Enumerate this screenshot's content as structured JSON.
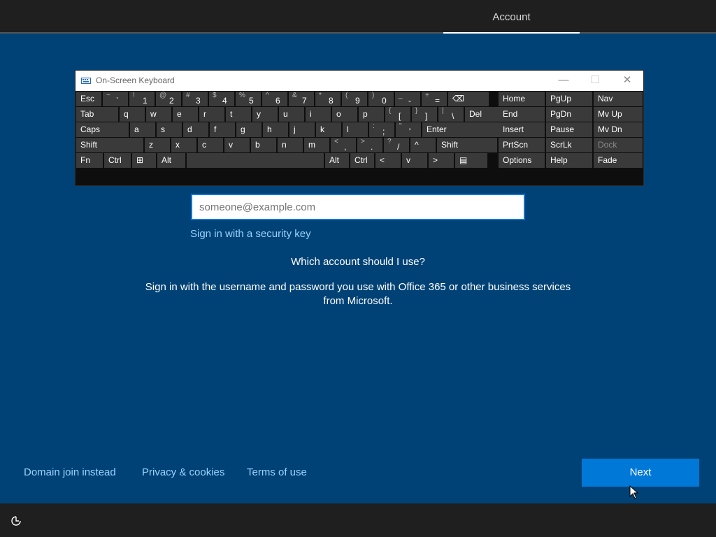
{
  "header": {
    "active_tab": "Account"
  },
  "osk": {
    "title": "On-Screen Keyboard",
    "window_controls": {
      "minimize": "—",
      "maximize": "☐",
      "close": "✕"
    },
    "row1": [
      {
        "label": "Esc"
      },
      {
        "shift": "~",
        "main": "`"
      },
      {
        "shift": "!",
        "main": "1"
      },
      {
        "shift": "@",
        "main": "2"
      },
      {
        "shift": "#",
        "main": "3"
      },
      {
        "shift": "$",
        "main": "4"
      },
      {
        "shift": "%",
        "main": "5"
      },
      {
        "shift": "^",
        "main": "6"
      },
      {
        "shift": "&",
        "main": "7"
      },
      {
        "shift": "*",
        "main": "8"
      },
      {
        "shift": "(",
        "main": "9"
      },
      {
        "shift": ")",
        "main": "0"
      },
      {
        "shift": "_",
        "main": "-"
      },
      {
        "shift": "+",
        "main": "="
      },
      {
        "label": "⌫"
      }
    ],
    "row2": [
      {
        "label": "Tab"
      },
      {
        "label": "q"
      },
      {
        "label": "w"
      },
      {
        "label": "e"
      },
      {
        "label": "r"
      },
      {
        "label": "t"
      },
      {
        "label": "y"
      },
      {
        "label": "u"
      },
      {
        "label": "i"
      },
      {
        "label": "o"
      },
      {
        "label": "p"
      },
      {
        "shift": "{",
        "main": "["
      },
      {
        "shift": "}",
        "main": "]"
      },
      {
        "shift": "|",
        "main": "\\"
      },
      {
        "label": "Del"
      }
    ],
    "row3": [
      {
        "label": "Caps"
      },
      {
        "label": "a"
      },
      {
        "label": "s"
      },
      {
        "label": "d"
      },
      {
        "label": "f"
      },
      {
        "label": "g"
      },
      {
        "label": "h"
      },
      {
        "label": "j"
      },
      {
        "label": "k"
      },
      {
        "label": "l"
      },
      {
        "shift": ":",
        "main": ";"
      },
      {
        "shift": "\"",
        "main": "'"
      },
      {
        "label": "Enter"
      }
    ],
    "row4": [
      {
        "label": "Shift"
      },
      {
        "label": "z"
      },
      {
        "label": "x"
      },
      {
        "label": "c"
      },
      {
        "label": "v"
      },
      {
        "label": "b"
      },
      {
        "label": "n"
      },
      {
        "label": "m"
      },
      {
        "shift": "<",
        "main": ","
      },
      {
        "shift": ">",
        "main": "."
      },
      {
        "shift": "?",
        "main": "/"
      },
      {
        "label": "^"
      },
      {
        "label": "Shift"
      }
    ],
    "row5": [
      {
        "label": "Fn"
      },
      {
        "label": "Ctrl"
      },
      {
        "label": "⊞"
      },
      {
        "label": "Alt"
      },
      {
        "label": ""
      },
      {
        "label": "Alt"
      },
      {
        "label": "Ctrl"
      },
      {
        "label": "<"
      },
      {
        "label": "v"
      },
      {
        "label": ">"
      },
      {
        "label": "▤"
      }
    ],
    "nav": [
      [
        "Home",
        "PgUp",
        "Nav"
      ],
      [
        "End",
        "PgDn",
        "Mv Up"
      ],
      [
        "Insert",
        "Pause",
        "Mv Dn"
      ],
      [
        "PrtScn",
        "ScrLk",
        "Dock"
      ],
      [
        "Options",
        "Help",
        "Fade"
      ]
    ]
  },
  "form": {
    "email_placeholder": "someone@example.com",
    "security_key_link": "Sign in with a security key",
    "question": "Which account should I use?",
    "description_line1": "Sign in with the username and password you use with Office 365 or other business services",
    "description_line2": "from Microsoft."
  },
  "footer": {
    "domain_join": "Domain join instead",
    "privacy": "Privacy & cookies",
    "terms": "Terms of use",
    "next": "Next"
  },
  "colors": {
    "background": "#004275",
    "accent": "#0078d7",
    "link": "#99d2ff"
  }
}
